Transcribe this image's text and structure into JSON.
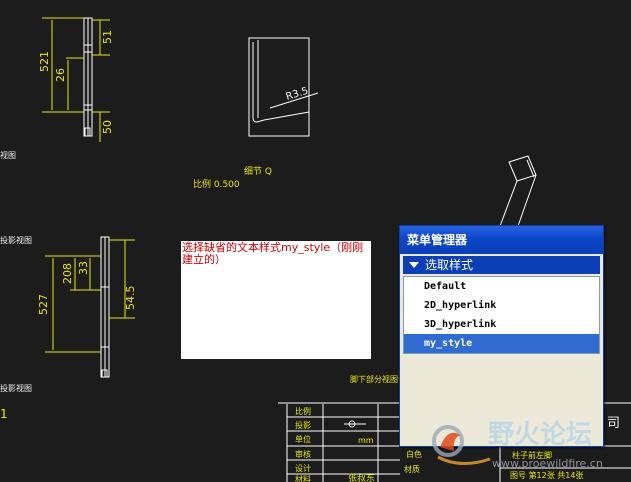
{
  "drawing": {
    "dims": {
      "d521": "521",
      "d26": "26",
      "d51": "51",
      "d50": "50",
      "d527": "527",
      "d208": "208",
      "d33": "33",
      "d545": "54.5"
    },
    "radius": "R3.5",
    "detail_label": "细节 Q",
    "scale_label": "比例 0.500",
    "left_labels": {
      "top": "视图",
      "mid": "投影视图",
      "low": "投影视图",
      "num": "1"
    },
    "foot_view_label": "脚下部分视图设",
    "title_block": {
      "rows": [
        "比例",
        "投影",
        "单位",
        "审核",
        "设计",
        "材料"
      ],
      "unit_value": "mm",
      "designer": "张叔东",
      "material_label": "材质",
      "part_name": "柱子前左脚",
      "sheet_info": "图号  第12张  共14张",
      "company_frag": "司",
      "material_frag": "白色"
    }
  },
  "note": {
    "text": "选择缺省的文本样式my_style（刚刚建立的）",
    "color": "#d00000"
  },
  "menu_manager": {
    "title": "菜单管理器",
    "command": "选取样式",
    "items": [
      {
        "label": "Default",
        "selected": false
      },
      {
        "label": "2D_hyperlink",
        "selected": false
      },
      {
        "label": "3D_hyperlink",
        "selected": false
      },
      {
        "label": "my_style",
        "selected": true
      }
    ]
  },
  "watermark": {
    "brand": "野火论坛",
    "url": "www.proewildfire.cn"
  },
  "colors": {
    "drawing_bg": "#1c1c1c",
    "geometry": "#ffffff",
    "dimension": "#e8e800",
    "menu_title": "#0b46c9",
    "selection": "#2f6bd0"
  }
}
